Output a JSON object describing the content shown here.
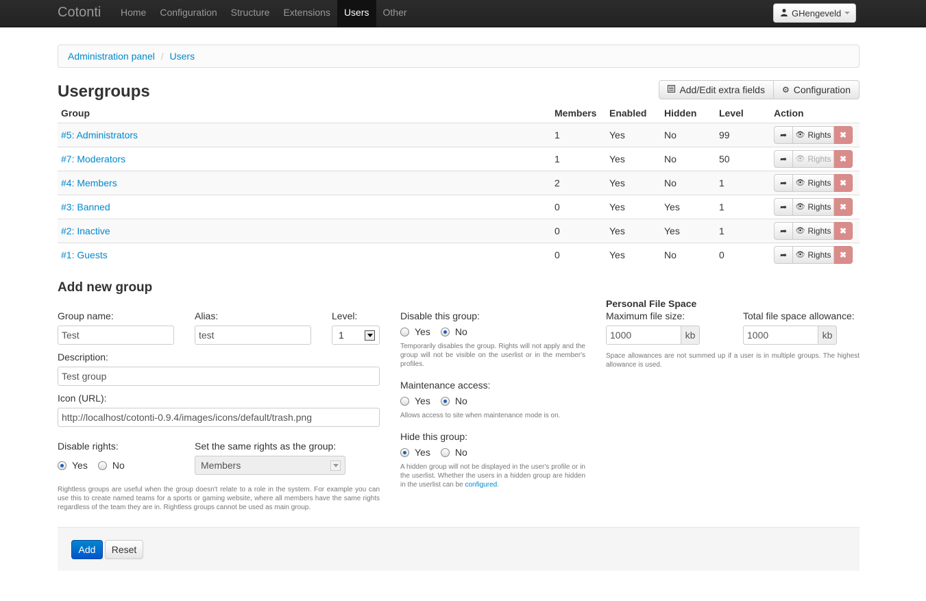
{
  "navbar": {
    "brand": "Cotonti",
    "items": [
      {
        "label": "Home",
        "active": false
      },
      {
        "label": "Configuration",
        "active": false
      },
      {
        "label": "Structure",
        "active": false
      },
      {
        "label": "Extensions",
        "active": false
      },
      {
        "label": "Users",
        "active": true
      },
      {
        "label": "Other",
        "active": false
      }
    ],
    "user": "GHengeveld",
    "user_icon": "user-icon"
  },
  "breadcrumb": {
    "items": [
      "Administration panel",
      "Users"
    ],
    "separator": "/"
  },
  "page": {
    "title": "Usergroups",
    "buttons": {
      "extra_fields": "Add/Edit extra fields",
      "configuration": "Configuration"
    }
  },
  "table": {
    "headers": [
      "Group",
      "Members",
      "Enabled",
      "Hidden",
      "Level",
      "Action"
    ],
    "rows": [
      {
        "group": "#5: Administrators",
        "members": "1",
        "enabled": "Yes",
        "hidden": "No",
        "level": "99",
        "rights_enabled": true
      },
      {
        "group": "#7: Moderators",
        "members": "1",
        "enabled": "Yes",
        "hidden": "No",
        "level": "50",
        "rights_enabled": false
      },
      {
        "group": "#4: Members",
        "members": "2",
        "enabled": "Yes",
        "hidden": "No",
        "level": "1",
        "rights_enabled": true
      },
      {
        "group": "#3: Banned",
        "members": "0",
        "enabled": "Yes",
        "hidden": "Yes",
        "level": "1",
        "rights_enabled": true
      },
      {
        "group": "#2: Inactive",
        "members": "0",
        "enabled": "Yes",
        "hidden": "Yes",
        "level": "1",
        "rights_enabled": true
      },
      {
        "group": "#1: Guests",
        "members": "0",
        "enabled": "Yes",
        "hidden": "No",
        "level": "0",
        "rights_enabled": true
      }
    ],
    "rights_label": "Rights"
  },
  "form": {
    "title": "Add new group",
    "group_name": {
      "label": "Group name:",
      "value": "Test"
    },
    "alias": {
      "label": "Alias:",
      "value": "test"
    },
    "level": {
      "label": "Level:",
      "value": "1"
    },
    "description": {
      "label": "Description:",
      "value": "Test group"
    },
    "icon": {
      "label": "Icon (URL):",
      "value": "http://localhost/cotonti-0.9.4/images/icons/default/trash.png"
    },
    "disable_rights": {
      "label": "Disable rights:",
      "yes": "Yes",
      "no": "No",
      "selected": "Yes"
    },
    "same_rights": {
      "label": "Set the same rights as the group:",
      "value": "Members"
    },
    "rightless_help": "Rightless groups are useful when the group doesn't relate to a role in the system. For example you can use this to create named teams for a sports or gaming website, where all members have the same rights regardless of the team they are in. Rightless groups cannot be used as main group.",
    "disable_group": {
      "label": "Disable this group:",
      "yes": "Yes",
      "no": "No",
      "selected": "No",
      "help": "Temporarily disables the group. Rights will not apply and the group will not be visible on the userlist or in the member's profiles."
    },
    "maintenance": {
      "label": "Maintenance access:",
      "yes": "Yes",
      "no": "No",
      "selected": "No",
      "help": "Allows access to site when maintenance mode is on."
    },
    "hide_group": {
      "label": "Hide this group:",
      "yes": "Yes",
      "no": "No",
      "selected": "Yes",
      "help": "A hidden group will not be displayed in the user's profile or in the userlist. Whether the users in a hidden group are hidden in the userlist can be",
      "help_link": "configured",
      "help_end": "."
    },
    "file_space": {
      "title": "Personal File Space",
      "max_label": "Maximum file size:",
      "max_value": "1000",
      "total_label": "Total file space allowance:",
      "total_value": "1000",
      "unit": "kb",
      "help": "Space allowances are not summed up if a user is in multiple groups. The highest allowance is used."
    },
    "buttons": {
      "add": "Add",
      "reset": "Reset"
    }
  },
  "colors": {
    "link": "#0088cc",
    "primary": "#0066cc",
    "danger": "#da8c8a",
    "navbar": "#222222"
  }
}
